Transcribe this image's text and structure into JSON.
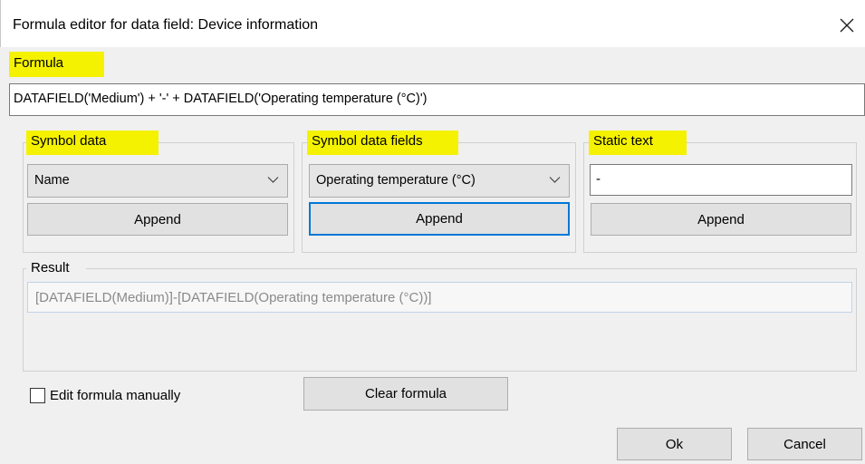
{
  "window": {
    "title": "Formula editor for data field: Device information",
    "close_icon": "close-icon"
  },
  "formula": {
    "label": "Formula",
    "value": "DATAFIELD('Medium') + '-' + DATAFIELD('Operating temperature (°C)')"
  },
  "symbol_data": {
    "label": "Symbol data",
    "selected": "Name",
    "append_label": "Append"
  },
  "symbol_data_fields": {
    "label": "Symbol data fields",
    "selected": "Operating temperature (°C)",
    "append_label": "Append"
  },
  "static_text": {
    "label": "Static text",
    "value": "-",
    "append_label": "Append"
  },
  "result": {
    "label": "Result",
    "value": "[DATAFIELD(Medium)]-[DATAFIELD(Operating temperature (°C))]"
  },
  "edit_manually": {
    "label": "Edit formula manually",
    "checked": false
  },
  "clear_formula_label": "Clear formula",
  "footer": {
    "ok_label": "Ok",
    "cancel_label": "Cancel"
  },
  "colors": {
    "highlight": "#f4f200",
    "focus_border": "#0078d7",
    "dialog_bg": "#f0f0f0"
  }
}
